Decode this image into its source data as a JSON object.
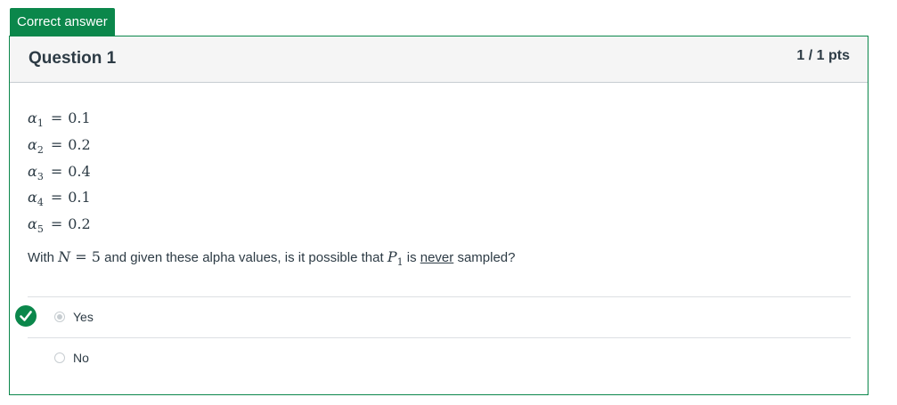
{
  "tag": {
    "label": "Correct answer"
  },
  "question": {
    "title": "Question 1",
    "points": "1 / 1 pts",
    "alphas": [
      {
        "sub": "1",
        "value": "0.1"
      },
      {
        "sub": "2",
        "value": "0.2"
      },
      {
        "sub": "3",
        "value": "0.4"
      },
      {
        "sub": "4",
        "value": "0.1"
      },
      {
        "sub": "5",
        "value": "0.2"
      }
    ],
    "text_before_N": "With ",
    "N_symbol": "N",
    "N_equals": "= 5",
    "text_middle": " and given these alpha values, is it possible that ",
    "P_symbol": "P",
    "P_sub": "1",
    "text_is": " is ",
    "text_never": "never",
    "text_after": " sampled?"
  },
  "answers": [
    {
      "label": "Yes",
      "selected": true,
      "correct": true
    },
    {
      "label": "No",
      "selected": false,
      "correct": false
    }
  ],
  "colors": {
    "correct": "#0b874b",
    "header_bg": "#f5f5f5",
    "text": "#2d3b45"
  }
}
